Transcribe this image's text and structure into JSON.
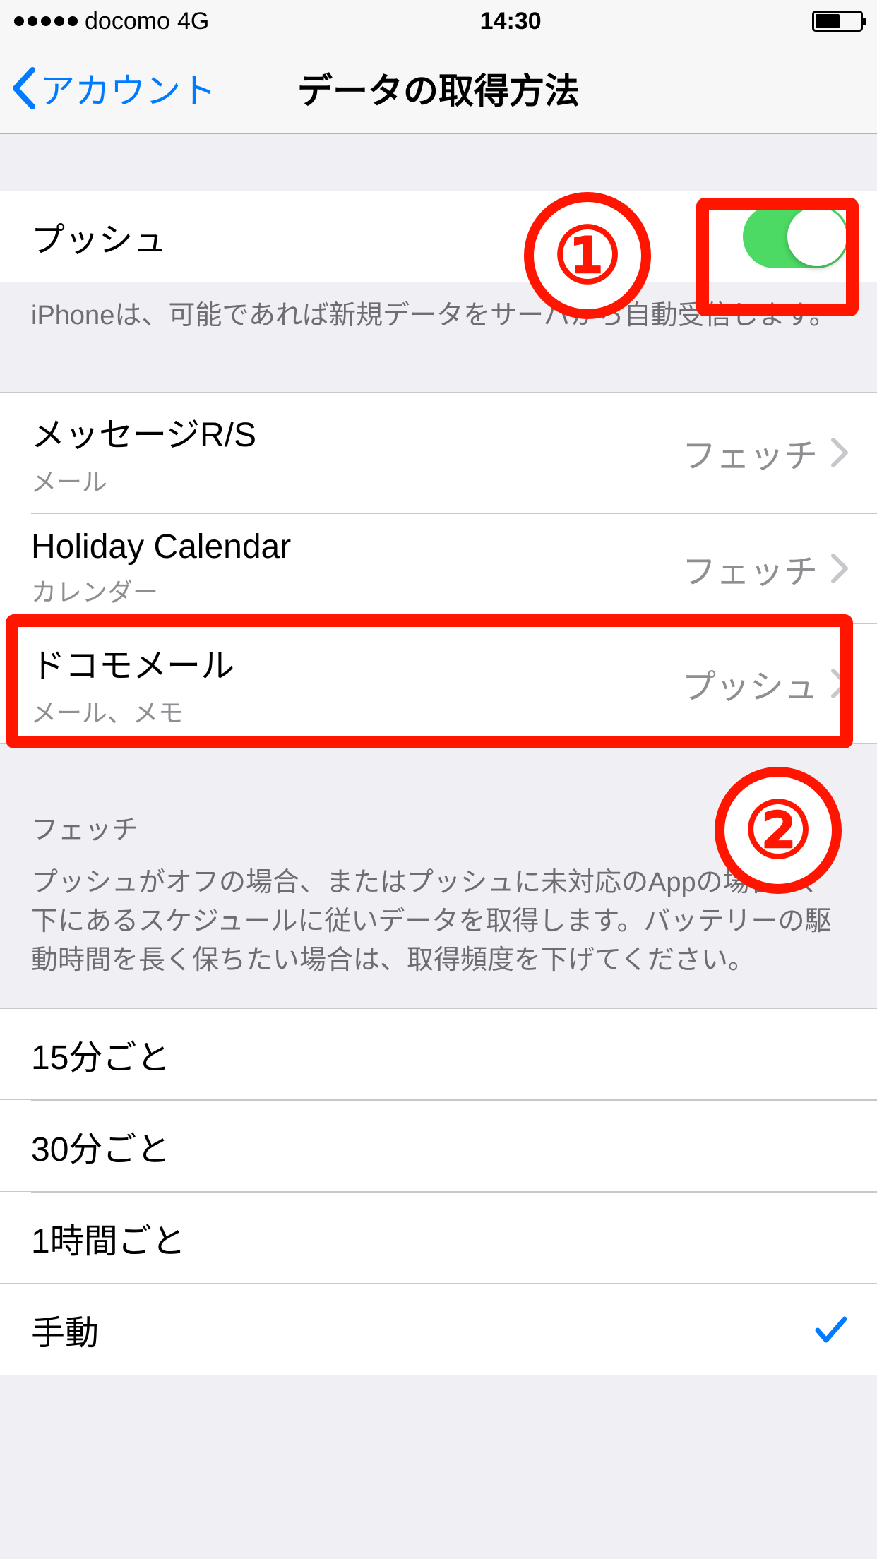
{
  "statusBar": {
    "carrier": "docomo",
    "network": "4G",
    "time": "14:30"
  },
  "nav": {
    "back": "アカウント",
    "title": "データの取得方法"
  },
  "push": {
    "label": "プッシュ",
    "enabled": true,
    "footer": "iPhoneは、可能であれば新規データをサーバから自動受信します。"
  },
  "accounts": [
    {
      "title": "メッセージR/S",
      "subtitle": "メール",
      "value": "フェッチ"
    },
    {
      "title": "Holiday Calendar",
      "subtitle": "カレンダー",
      "value": "フェッチ"
    },
    {
      "title": "ドコモメール",
      "subtitle": "メール、メモ",
      "value": "プッシュ"
    }
  ],
  "fetch": {
    "header": "フェッチ",
    "desc": "プッシュがオフの場合、またはプッシュに未対応のAppの場合は、下にあるスケジュールに従いデータを取得します。バッテリーの駆動時間を長く保ちたい場合は、取得頻度を下げてください。",
    "options": [
      {
        "label": "15分ごと",
        "selected": false
      },
      {
        "label": "30分ごと",
        "selected": false
      },
      {
        "label": "1時間ごと",
        "selected": false
      },
      {
        "label": "手動",
        "selected": true
      }
    ]
  },
  "annotations": {
    "badge1": "①",
    "badge2": "②"
  }
}
